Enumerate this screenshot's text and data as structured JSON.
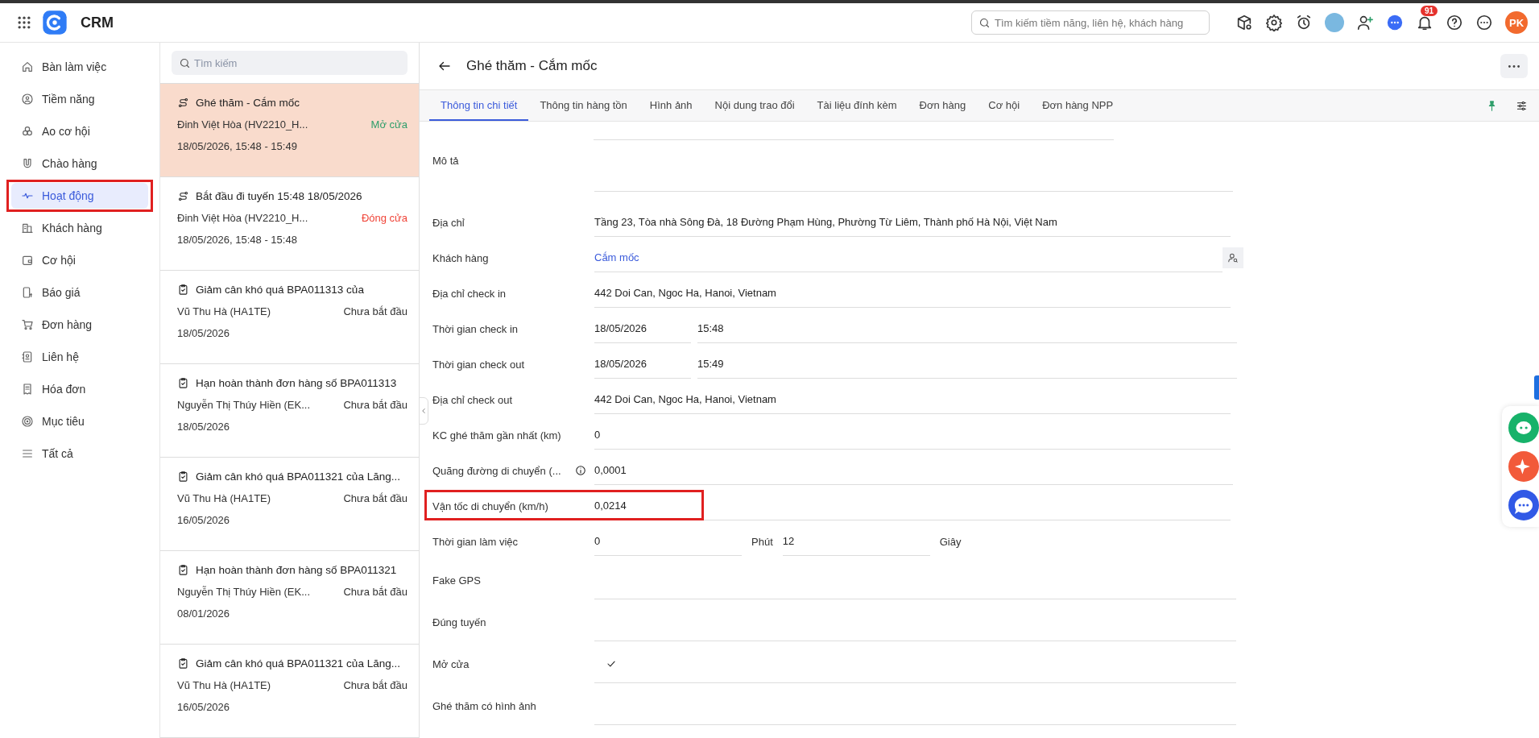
{
  "app": {
    "name": "CRM"
  },
  "search": {
    "placeholder": "Tìm kiếm tiềm năng, liên hệ, khách hàng"
  },
  "notifications": {
    "count": "91"
  },
  "user": {
    "initials": "PK"
  },
  "sidebar": {
    "items": [
      {
        "label": "Bàn làm việc",
        "selected": false,
        "highlighted": false
      },
      {
        "label": "Tiềm năng",
        "selected": false,
        "highlighted": false
      },
      {
        "label": "Ao cơ hội",
        "selected": false,
        "highlighted": false
      },
      {
        "label": "Chào hàng",
        "selected": false,
        "highlighted": false
      },
      {
        "label": "Hoạt động",
        "selected": true,
        "highlighted": true
      },
      {
        "label": "Khách hàng",
        "selected": false,
        "highlighted": false
      },
      {
        "label": "Cơ hội",
        "selected": false,
        "highlighted": false
      },
      {
        "label": "Báo giá",
        "selected": false,
        "highlighted": false
      },
      {
        "label": "Đơn hàng",
        "selected": false,
        "highlighted": false
      },
      {
        "label": "Liên hệ",
        "selected": false,
        "highlighted": false
      },
      {
        "label": "Hóa đơn",
        "selected": false,
        "highlighted": false
      },
      {
        "label": "Mục tiêu",
        "selected": false,
        "highlighted": false
      },
      {
        "label": "Tất cả",
        "selected": false,
        "highlighted": false
      }
    ]
  },
  "activity_list": {
    "search_placeholder": "Tìm kiếm",
    "items": [
      {
        "kind": "route",
        "title": "Ghé thăm - Cắm mốc",
        "person": "Đinh Việt Hòa (HV2210_H...",
        "status": "Mở cửa",
        "color": "#2e9e6a",
        "date": "18/05/2026, 15:48 - 15:49",
        "selected": true
      },
      {
        "kind": "route",
        "title": "Bắt đầu đi tuyến 15:48 18/05/2026",
        "person": "Đinh Việt Hòa (HV2210_H...",
        "status": "Đóng cửa",
        "color": "#f04438",
        "date": "18/05/2026, 15:48 - 15:48",
        "selected": false
      },
      {
        "kind": "task",
        "title": "Giảm cân khó quá BPA011313 của",
        "person": "Vũ Thu Hà (HA1TE)",
        "status": "Chưa bắt đầu",
        "color": "#333333",
        "date": "18/05/2026",
        "selected": false
      },
      {
        "kind": "task",
        "title": "Hạn hoàn thành đơn hàng số BPA011313",
        "person": "Nguyễn Thị Thúy Hiền (EK...",
        "status": "Chưa bắt đầu",
        "color": "#333333",
        "date": "18/05/2026",
        "selected": false
      },
      {
        "kind": "task",
        "title": "Giảm cân khó quá BPA011321 của Lăng...",
        "person": "Vũ Thu Hà (HA1TE)",
        "status": "Chưa bắt đầu",
        "color": "#333333",
        "date": "16/05/2026",
        "selected": false
      },
      {
        "kind": "task",
        "title": "Hạn hoàn thành đơn hàng số BPA011321",
        "person": "Nguyễn Thị Thúy Hiền (EK...",
        "status": "Chưa bắt đầu",
        "color": "#333333",
        "date": "08/01/2026",
        "selected": false
      },
      {
        "kind": "task",
        "title": "Giảm cân khó quá BPA011321 của Lăng...",
        "person": "Vũ Thu Hà (HA1TE)",
        "status": "Chưa bắt đầu",
        "color": "#333333",
        "date": "16/05/2026",
        "selected": false
      }
    ]
  },
  "detail": {
    "title": "Ghé thăm - Cắm mốc",
    "tabs": [
      {
        "label": "Thông tin chi tiết",
        "selected": true
      },
      {
        "label": "Thông tin hàng tồn",
        "selected": false
      },
      {
        "label": "Hình ảnh",
        "selected": false
      },
      {
        "label": "Nội dung trao đổi",
        "selected": false
      },
      {
        "label": "Tài liệu đính kèm",
        "selected": false
      },
      {
        "label": "Đơn hàng",
        "selected": false
      },
      {
        "label": "Cơ hội",
        "selected": false
      },
      {
        "label": "Đơn hàng NPP",
        "selected": false
      }
    ],
    "fields": [
      {
        "kind": "textarea",
        "label": "Mô tả",
        "highlighted": false
      },
      {
        "kind": "text",
        "label": "Địa chỉ",
        "value": "Tầng 23, Tòa nhà Sông Đà, 18 Đường Phạm Hùng, Phường Từ Liêm, Thành phố Hà Nội, Việt Nam",
        "highlighted": false
      },
      {
        "kind": "link",
        "label": "Khách hàng",
        "value": "Cắm mốc",
        "highlighted": false
      },
      {
        "kind": "text",
        "label": "Địa chỉ check in",
        "value": "442 Doi Can, Ngoc Ha, Hanoi, Vietnam",
        "highlighted": false
      },
      {
        "kind": "datetime",
        "label": "Thời gian check in",
        "date": "18/05/2026",
        "time": "15:48",
        "highlighted": false
      },
      {
        "kind": "datetime",
        "label": "Thời gian check out",
        "date": "18/05/2026",
        "time": "15:49",
        "highlighted": false
      },
      {
        "kind": "text",
        "label": "Địa chỉ check out",
        "value": "442 Doi Can, Ngoc Ha, Hanoi, Vietnam",
        "highlighted": false
      },
      {
        "kind": "text",
        "label": "KC ghé thăm gần nhất (km)",
        "value": "0",
        "highlighted": false
      },
      {
        "kind": "info",
        "label": "Quãng đường di chuyển (...",
        "value": "0,0001",
        "highlighted": false
      },
      {
        "kind": "text",
        "label": "Vận tốc di chuyển (km/h)",
        "value": "0,0214",
        "highlighted": true
      },
      {
        "kind": "duration",
        "label": "Thời gian làm việc",
        "minutes": "0",
        "minutes_unit": "Phút",
        "seconds": "12",
        "seconds_unit": "Giây",
        "highlighted": false
      },
      {
        "kind": "check",
        "label": "Fake GPS",
        "checked": false,
        "highlighted": false
      },
      {
        "kind": "check",
        "label": "Đúng tuyến",
        "checked": false,
        "highlighted": false
      },
      {
        "kind": "check",
        "label": "Mở cửa",
        "checked": true,
        "highlighted": false
      },
      {
        "kind": "check",
        "label": "Ghé thăm có hình ảnh",
        "checked": false,
        "highlighted": false
      }
    ]
  }
}
